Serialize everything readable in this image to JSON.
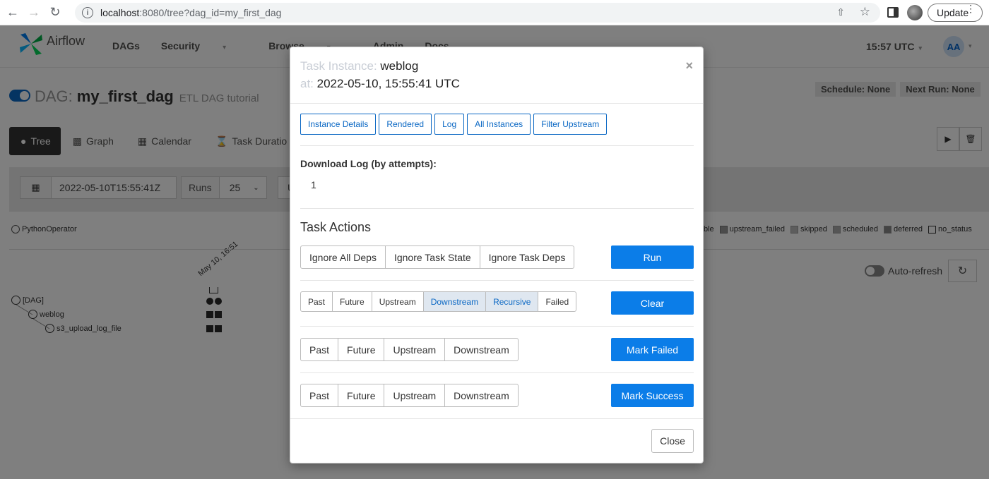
{
  "browser": {
    "url_host": "localhost",
    "url_path": ":8080/tree?dag_id=my_first_dag",
    "update_label": "Update"
  },
  "navbar": {
    "brand": "Airflow",
    "menu": [
      "DAGs",
      "Security",
      "Browse",
      "Admin",
      "Docs"
    ],
    "clock": "15:57 UTC",
    "avatar": "AA"
  },
  "dag": {
    "label": "DAG:",
    "name": "my_first_dag",
    "description": "ETL DAG tutorial",
    "schedule": "Schedule: None",
    "next_run": "Next Run: None"
  },
  "view_tabs": [
    "Tree",
    "Graph",
    "Calendar",
    "Task Duratio"
  ],
  "filters": {
    "base_date": "2022-05-10T15:55:41Z",
    "runs_label": "Runs",
    "runs_value": "25",
    "update_partial": "Up"
  },
  "legend": {
    "operator": "PythonOperator",
    "states": [
      "ble",
      "upstream_failed",
      "skipped",
      "scheduled",
      "deferred",
      "no_status"
    ]
  },
  "auto_refresh_label": "Auto-refresh",
  "tree": {
    "run_label": "May 10, 16:51",
    "nodes": [
      "[DAG]",
      "weblog",
      "s3_upload_log_file"
    ]
  },
  "modal": {
    "task_instance_label": "Task Instance:",
    "task_id": "weblog",
    "at_label": "at:",
    "execution_date": "2022-05-10, 15:55:41 UTC",
    "tabs": [
      "Instance Details",
      "Rendered",
      "Log",
      "All Instances",
      "Filter Upstream"
    ],
    "download_log_title": "Download Log (by attempts):",
    "attempts": [
      "1"
    ],
    "task_actions_title": "Task Actions",
    "run_options": [
      "Ignore All Deps",
      "Ignore Task State",
      "Ignore Task Deps"
    ],
    "run_label": "Run",
    "clear_options": [
      "Past",
      "Future",
      "Upstream",
      "Downstream",
      "Recursive",
      "Failed"
    ],
    "clear_active": [
      "Downstream",
      "Recursive"
    ],
    "clear_label": "Clear",
    "failed_options": [
      "Past",
      "Future",
      "Upstream",
      "Downstream"
    ],
    "mark_failed_label": "Mark Failed",
    "success_options": [
      "Past",
      "Future",
      "Upstream",
      "Downstream"
    ],
    "mark_success_label": "Mark Success",
    "close_label": "Close"
  },
  "colors": {
    "primary": "#0b7de8",
    "link": "#0b68c4",
    "backdrop": "rgba(0,0,0,0.5)"
  }
}
